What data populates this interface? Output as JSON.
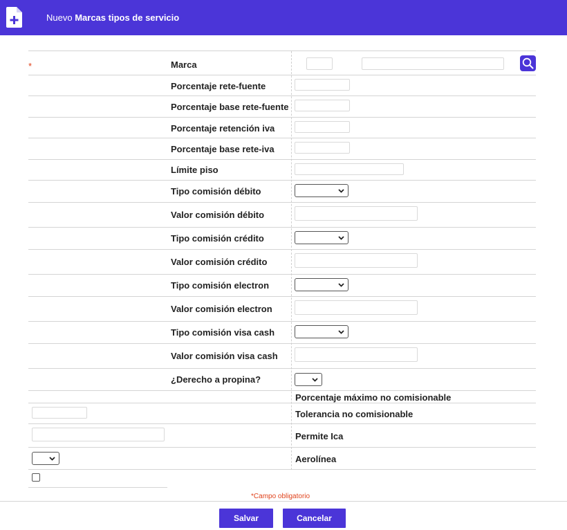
{
  "header": {
    "title_prefix": "Nuevo",
    "title_main": "Marcas tipos de servicio",
    "icon": "document-add-icon"
  },
  "form": {
    "required_marker": "*",
    "marca_label": "Marca",
    "fields": [
      {
        "label": "Porcentaje rete-fuente"
      },
      {
        "label": "Porcentaje base rete-fuente"
      },
      {
        "label": "Porcentaje retención iva"
      },
      {
        "label": "Porcentaje base rete-iva"
      },
      {
        "label": "Límite piso"
      },
      {
        "label": "Tipo comisión débito"
      },
      {
        "label": "Valor comisión débito"
      },
      {
        "label": "Tipo comisión crédito"
      },
      {
        "label": "Valor comisión crédito"
      },
      {
        "label": "Tipo comisión electron"
      },
      {
        "label": "Valor comisión electron"
      },
      {
        "label": "Tipo comisión visa cash"
      },
      {
        "label": "Valor comisión visa cash"
      },
      {
        "label": "¿Derecho a propina?"
      }
    ],
    "right_labels": [
      "Porcentaje máximo no comisionable",
      "Tolerancia no comisionable",
      "Permite Ica",
      "Aerolínea"
    ],
    "search_icon": "search-icon"
  },
  "footer": {
    "required_note_marker": "*",
    "required_note": "Campo obligatorio",
    "save_label": "Salvar",
    "cancel_label": "Cancelar"
  },
  "colors": {
    "accent": "#4b35d8",
    "required": "#e0421b"
  }
}
